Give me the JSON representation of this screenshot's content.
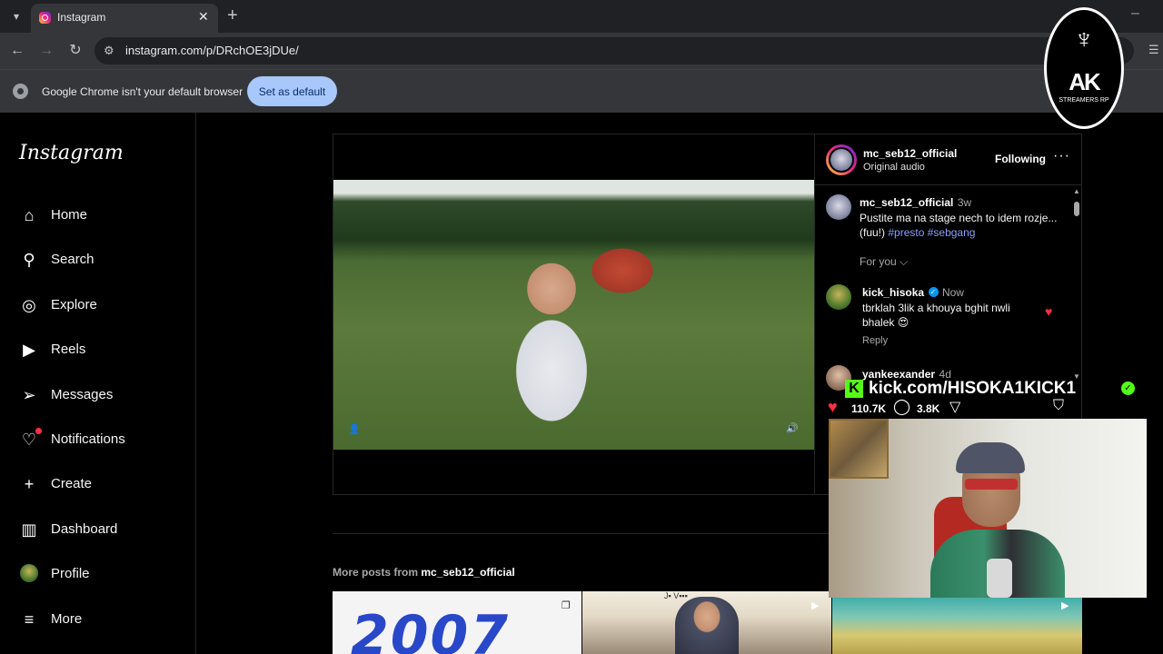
{
  "browser": {
    "tab_title": "Instagram",
    "url": "instagram.com/p/DRchOE3jDUe/",
    "infobar_text": "Google Chrome isn't your default browser",
    "set_default_label": "Set as default"
  },
  "sidebar": {
    "logo": "Instagram",
    "items": [
      {
        "label": "Home",
        "icon": "home-icon"
      },
      {
        "label": "Search",
        "icon": "search-icon"
      },
      {
        "label": "Explore",
        "icon": "compass-icon"
      },
      {
        "label": "Reels",
        "icon": "reels-icon"
      },
      {
        "label": "Messages",
        "icon": "send-icon"
      },
      {
        "label": "Notifications",
        "icon": "heart-icon"
      },
      {
        "label": "Create",
        "icon": "plus-icon"
      },
      {
        "label": "Dashboard",
        "icon": "dashboard-icon"
      },
      {
        "label": "Profile",
        "icon": "avatar"
      },
      {
        "label": "More",
        "icon": "menu-icon"
      }
    ]
  },
  "post": {
    "username": "mc_seb12_official",
    "audio": "Original audio",
    "following_label": "Following",
    "caption": {
      "user": "mc_seb12_official",
      "time": "3w",
      "text": "Pustite ma na stage nech to idem rozje...(fuu!)",
      "hashtags": "#presto #sebgang"
    },
    "for_you_label": "For you",
    "comments": [
      {
        "user": "kick_hisoka",
        "time": "Now",
        "text": "tbrklah 3lik a khouya bghit nwli bhalek 😍",
        "reply_label": "Reply"
      },
      {
        "user": "yankeexander",
        "time": "4d"
      }
    ],
    "likes": "110.7K",
    "comment_count": "3.8K"
  },
  "more_posts": {
    "prefix": "More posts from",
    "user": "mc_seb12_official",
    "thumb1_text": "2007",
    "thumb2_text": "J▪ V▪▪▪"
  },
  "overlay": {
    "kick_url": "kick.com/HISOKA1KICK1",
    "badge_text": "AK",
    "badge_sub": "STREAMERS RP"
  },
  "colors": {
    "accent_blue": "#0095f6",
    "like_red": "#ff3040",
    "kick_green": "#53fc18",
    "chrome_button": "#a8c7fa"
  }
}
